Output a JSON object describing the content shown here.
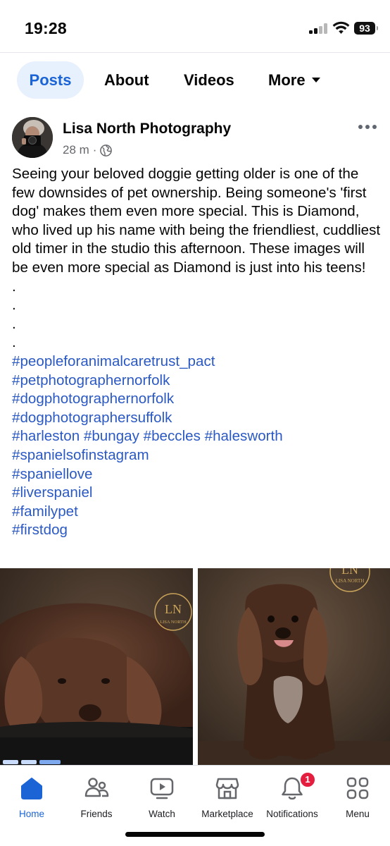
{
  "status_bar": {
    "time": "19:28",
    "battery": "93"
  },
  "tabs": [
    {
      "label": "Posts"
    },
    {
      "label": "About"
    },
    {
      "label": "Videos"
    },
    {
      "label": "More"
    }
  ],
  "post": {
    "author": "Lisa North Photography",
    "time": "28 m",
    "separator": "·",
    "body": "Seeing your beloved doggie getting older is one of the few downsides of pet ownership. Being someone's 'first dog' makes them even more special. This is Diamond, who lived up his name with being the friendliest, cuddliest old timer in the studio this afternoon. These images will be even more special as Diamond is just into his teens!",
    "dots": [
      ".",
      ".",
      ".",
      "."
    ],
    "hashtags": [
      "#peopleforanimalcaretrust_pact",
      "#petphotographernorfolk",
      "#dogphotographernorfolk",
      "#dogphotographersuffolk",
      "#harleston #bungay #beccles #halesworth",
      "#spanielsofinstagram",
      "#spaniellove",
      "#liverspaniel",
      "#familypet",
      "#firstdog"
    ],
    "watermark": {
      "monogram": "LN",
      "name": "LISA NORTH"
    }
  },
  "bottom_nav": [
    {
      "label": "Home",
      "icon": "home-icon"
    },
    {
      "label": "Friends",
      "icon": "friends-icon"
    },
    {
      "label": "Watch",
      "icon": "watch-icon"
    },
    {
      "label": "Marketplace",
      "icon": "marketplace-icon"
    },
    {
      "label": "Notifications",
      "icon": "bell-icon",
      "badge": "1"
    },
    {
      "label": "Menu",
      "icon": "menu-icon"
    }
  ],
  "colors": {
    "accent": "#1b64d6",
    "hashtag": "#2b59c3",
    "badge": "#e41e3f",
    "meta": "#65676b"
  }
}
